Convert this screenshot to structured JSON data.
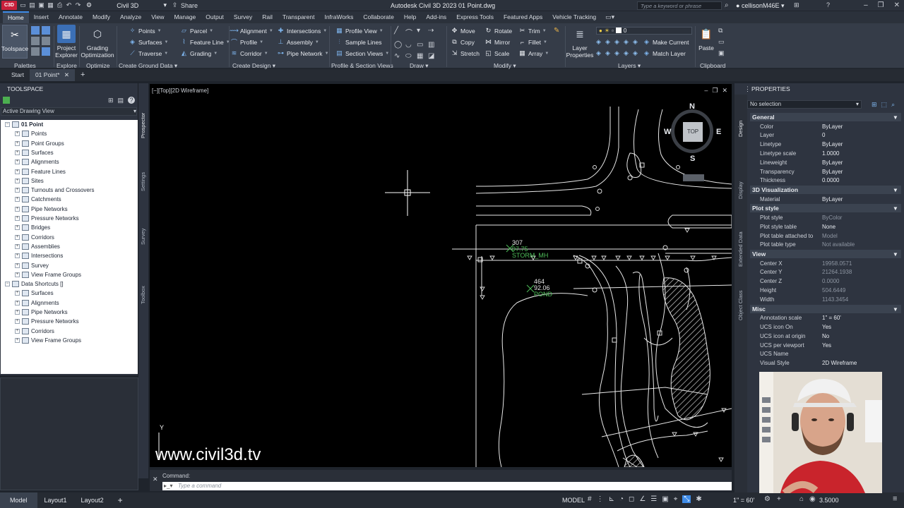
{
  "titlebar": {
    "app_logo": "C3D",
    "workspace": "Civil 3D",
    "share": "Share",
    "title": "Autodesk Civil 3D 2023    01 Point.dwg",
    "search_placeholder": "Type a keyword or phrase",
    "user": "cellisonM46E"
  },
  "menu": [
    "Home",
    "Insert",
    "Annotate",
    "Modify",
    "Analyze",
    "View",
    "Manage",
    "Output",
    "Survey",
    "Rail",
    "Transparent",
    "InfraWorks",
    "Collaborate",
    "Help",
    "Add-ins",
    "Express Tools",
    "Featured Apps",
    "Vehicle Tracking"
  ],
  "ribbon": {
    "big": {
      "toolspace": "Toolspace",
      "project_explorer": "Project Explorer",
      "grading_optimization": "Grading Optimization",
      "layer_properties": "Layer Properties",
      "paste": "Paste"
    },
    "ground": [
      "Points",
      "Surfaces",
      "Traverse",
      "Parcel",
      "Feature Line",
      "Grading"
    ],
    "design": [
      "Alignment",
      "Profile",
      "Corridor",
      "Intersections",
      "Assembly",
      "Pipe Network"
    ],
    "profile": [
      "Profile View",
      "Sample Lines",
      "Section Views"
    ],
    "modify": [
      "Move",
      "Rotate",
      "Trim",
      "Copy",
      "Mirror",
      "Fillet",
      "Stretch",
      "Scale",
      "Array"
    ],
    "layers": [
      "Make Current",
      "Match Layer"
    ],
    "layer_value": "0",
    "panels": {
      "palettes": "Palettes",
      "explore": "Explore",
      "optimize": "Optimize",
      "create_ground": "Create Ground Data",
      "create_design": "Create Design",
      "profile_section": "Profile & Section Views",
      "draw": "Draw",
      "modify": "Modify",
      "layers": "Layers",
      "clipboard": "Clipboard"
    }
  },
  "doctabs": [
    "Start",
    "01 Point*"
  ],
  "toolspace": {
    "title": "TOOLSPACE",
    "view": "Active Drawing View",
    "side_tabs": [
      "Prospector",
      "Settings",
      "Survey",
      "Toolbox"
    ],
    "tree": [
      {
        "label": "01 Point",
        "level": 0,
        "bold": true
      },
      {
        "label": "Points",
        "level": 1
      },
      {
        "label": "Point Groups",
        "level": 1
      },
      {
        "label": "Surfaces",
        "level": 1
      },
      {
        "label": "Alignments",
        "level": 1
      },
      {
        "label": "Feature Lines",
        "level": 1
      },
      {
        "label": "Sites",
        "level": 1
      },
      {
        "label": "Turnouts and Crossovers",
        "level": 1
      },
      {
        "label": "Catchments",
        "level": 1
      },
      {
        "label": "Pipe Networks",
        "level": 1
      },
      {
        "label": "Pressure Networks",
        "level": 1
      },
      {
        "label": "Bridges",
        "level": 1
      },
      {
        "label": "Corridors",
        "level": 1
      },
      {
        "label": "Assemblies",
        "level": 1
      },
      {
        "label": "Intersections",
        "level": 1
      },
      {
        "label": "Survey",
        "level": 1
      },
      {
        "label": "View Frame Groups",
        "level": 1
      },
      {
        "label": "Data Shortcuts []",
        "level": 0
      },
      {
        "label": "Surfaces",
        "level": 1
      },
      {
        "label": "Alignments",
        "level": 1
      },
      {
        "label": "Pipe Networks",
        "level": 1
      },
      {
        "label": "Pressure Networks",
        "level": 1
      },
      {
        "label": "Corridors",
        "level": 1
      },
      {
        "label": "View Frame Groups",
        "level": 1
      }
    ]
  },
  "viewport": {
    "label": "[−][Top][2D Wireframe]",
    "compass": {
      "n": "N",
      "s": "S",
      "e": "E",
      "w": "W",
      "top": "TOP"
    },
    "points": [
      {
        "num": "307",
        "elev": "97.75",
        "desc": "STORM_MH"
      },
      {
        "num": "464",
        "elev": "92.06",
        "desc": "POND"
      }
    ],
    "axis_y": "Y",
    "watermark": "www.civil3d.tv"
  },
  "command": {
    "history": "Command:",
    "placeholder": "Type a command"
  },
  "status": {
    "tabs": [
      "Model",
      "Layout1",
      "Layout2"
    ],
    "model": "MODEL",
    "scale": "1\" = 60'",
    "value": "3.5000"
  },
  "properties": {
    "title": "PROPERTIES",
    "selection": "No selection",
    "side_tabs": [
      "Design",
      "Display",
      "Extended Data",
      "Object Class"
    ],
    "sections": [
      {
        "name": "General",
        "rows": [
          [
            "Color",
            "ByLayer"
          ],
          [
            "Layer",
            "0"
          ],
          [
            "Linetype",
            "ByLayer"
          ],
          [
            "Linetype scale",
            "1.0000"
          ],
          [
            "Lineweight",
            "ByLayer"
          ],
          [
            "Transparency",
            "ByLayer"
          ],
          [
            "Thickness",
            "0.0000"
          ]
        ]
      },
      {
        "name": "3D Visualization",
        "rows": [
          [
            "Material",
            "ByLayer"
          ]
        ]
      },
      {
        "name": "Plot style",
        "rows": [
          [
            "Plot style",
            "ByColor"
          ],
          [
            "Plot style table",
            "None"
          ],
          [
            "Plot table attached to",
            "Model"
          ],
          [
            "Plot table type",
            "Not available"
          ]
        ]
      },
      {
        "name": "View",
        "rows": [
          [
            "Center X",
            "19958.0571"
          ],
          [
            "Center Y",
            "21264.1938"
          ],
          [
            "Center Z",
            "0.0000"
          ],
          [
            "Height",
            "504.6449"
          ],
          [
            "Width",
            "1143.3454"
          ]
        ]
      },
      {
        "name": "Misc",
        "rows": [
          [
            "Annotation scale",
            "1\" = 60'"
          ],
          [
            "UCS icon On",
            "Yes"
          ],
          [
            "UCS icon at origin",
            "No"
          ],
          [
            "UCS per viewport",
            "Yes"
          ],
          [
            "UCS Name",
            ""
          ],
          [
            "Visual Style",
            "2D Wireframe"
          ]
        ]
      }
    ]
  }
}
